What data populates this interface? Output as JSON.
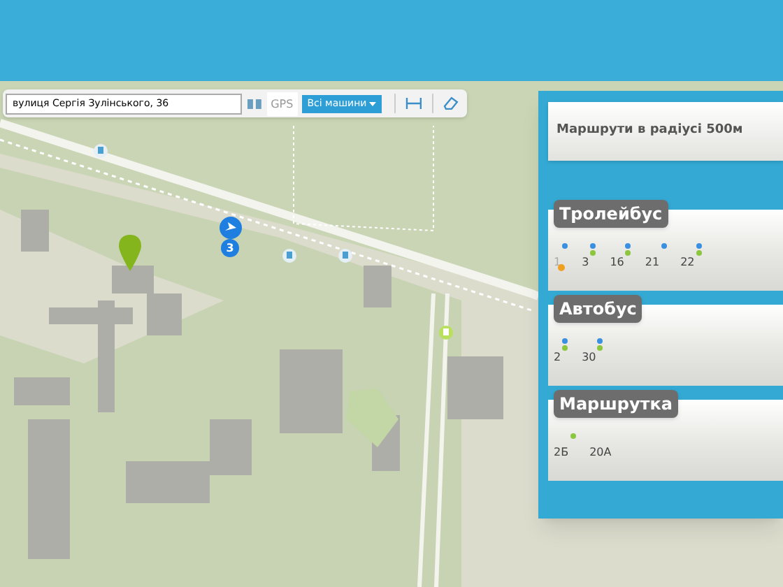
{
  "toolbar": {
    "address": "вулиця Сергія Зулінського, 36",
    "gps_label": "GPS",
    "vehicles_button": "Всі машини"
  },
  "panel": {
    "title": "Маршрути в радіусі 500м",
    "sections": [
      {
        "title": "Тролейбус",
        "routes": [
          {
            "label": "1",
            "accessible": true,
            "dots": [
              {
                "color": "#3b8fe0"
              }
            ]
          },
          {
            "label": "3",
            "accessible": false,
            "dots": [
              {
                "color": "#3b8fe0"
              },
              {
                "color": "#8cc63f"
              }
            ]
          },
          {
            "label": "16",
            "accessible": false,
            "dots": [
              {
                "color": "#3b8fe0"
              },
              {
                "color": "#8cc63f"
              }
            ]
          },
          {
            "label": "21",
            "accessible": false,
            "dots": [
              {
                "color": "#3b8fe0"
              }
            ]
          },
          {
            "label": "22",
            "accessible": false,
            "dots": [
              {
                "color": "#3b8fe0"
              },
              {
                "color": "#8cc63f"
              }
            ]
          }
        ]
      },
      {
        "title": "Автобус",
        "routes": [
          {
            "label": "2",
            "accessible": false,
            "dots": [
              {
                "color": "#3b8fe0"
              },
              {
                "color": "#8cc63f"
              }
            ]
          },
          {
            "label": "30",
            "accessible": false,
            "dots": [
              {
                "color": "#3b8fe0"
              },
              {
                "color": "#8cc63f"
              }
            ]
          }
        ]
      },
      {
        "title": "Маршрутка",
        "routes": [
          {
            "label": "2Б",
            "accessible": false,
            "dots": [
              {
                "color": "#8cc63f"
              }
            ]
          },
          {
            "label": "20А",
            "accessible": false
          }
        ]
      }
    ]
  },
  "map": {
    "cluster_count": "3"
  }
}
